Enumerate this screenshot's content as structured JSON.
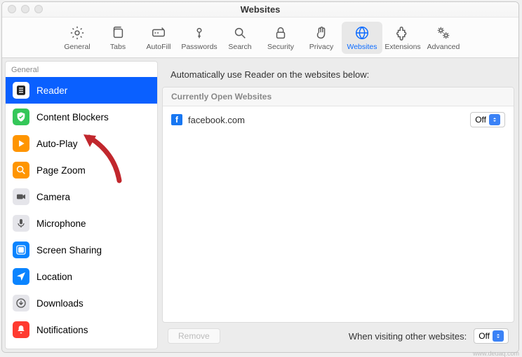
{
  "window": {
    "title": "Websites"
  },
  "toolbar": [
    {
      "label": "General"
    },
    {
      "label": "Tabs"
    },
    {
      "label": "AutoFill"
    },
    {
      "label": "Passwords"
    },
    {
      "label": "Search"
    },
    {
      "label": "Security"
    },
    {
      "label": "Privacy"
    },
    {
      "label": "Websites"
    },
    {
      "label": "Extensions"
    },
    {
      "label": "Advanced"
    }
  ],
  "sidebar": {
    "heading": "General",
    "items": [
      {
        "label": "Reader"
      },
      {
        "label": "Content Blockers"
      },
      {
        "label": "Auto-Play"
      },
      {
        "label": "Page Zoom"
      },
      {
        "label": "Camera"
      },
      {
        "label": "Microphone"
      },
      {
        "label": "Screen Sharing"
      },
      {
        "label": "Location"
      },
      {
        "label": "Downloads"
      },
      {
        "label": "Notifications"
      }
    ]
  },
  "main": {
    "heading": "Automatically use Reader on the websites below:",
    "section_label": "Currently Open Websites",
    "sites": [
      {
        "name": "facebook.com",
        "setting": "Off"
      }
    ],
    "remove_btn": "Remove",
    "footer_label": "When visiting other websites:",
    "footer_value": "Off"
  },
  "watermark": "www.deuaq.com"
}
